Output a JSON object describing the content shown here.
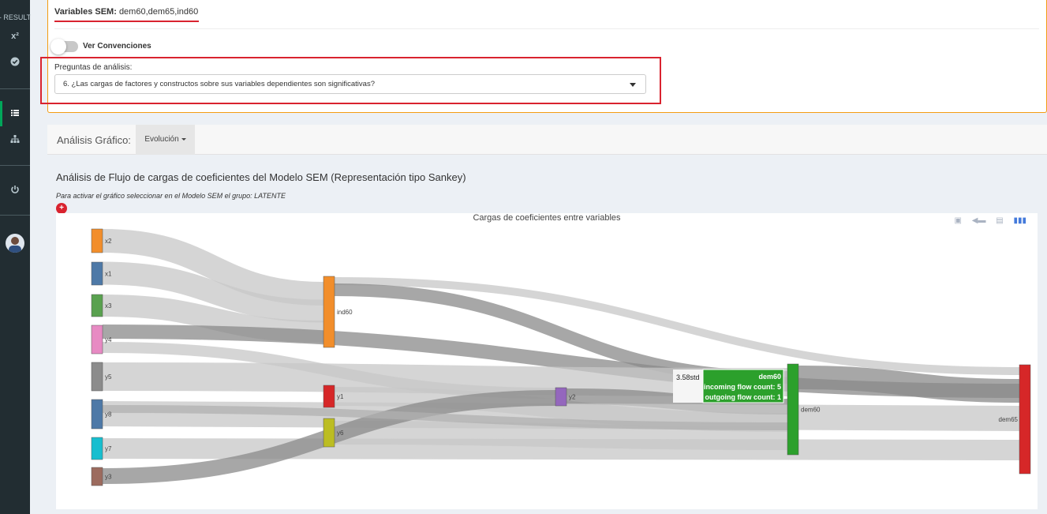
{
  "sidebar": {
    "header_label": "- RESULT",
    "x2_label": "x²",
    "check_icon": "check-circle-icon",
    "list_icon": "list-icon",
    "sitemap_icon": "sitemap-icon",
    "power_icon": "power-icon"
  },
  "top_panel": {
    "variables_label": "Variables SEM:",
    "variables_value": "dem60,dem65,ind60",
    "toggle_label": "Ver Convenciones",
    "preguntas_label": "Preguntas de análisis:",
    "selected_question": "6. ¿Las cargas de factores y constructos sobre sus variables dependientes son significativas?"
  },
  "graph_bar": {
    "title": "Análisis Gráfico:",
    "dropdown_label": "Evolución"
  },
  "section": {
    "title": "Análisis de Flujo de cargas de coeficientes del Modelo SEM (Representación tipo Sankey)",
    "note": "Para activar el gráfico seleccionar en el Modelo SEM el grupo: LATENTE"
  },
  "chart_data": {
    "type": "sankey",
    "title": "Cargas de coeficientes entre variables",
    "nodes": [
      {
        "name": "x2",
        "color": "#f28e2b"
      },
      {
        "name": "x1",
        "color": "#4e79a7"
      },
      {
        "name": "x3",
        "color": "#59a14f"
      },
      {
        "name": "y4",
        "color": "#e78ac3"
      },
      {
        "name": "y5",
        "color": "#8c8c8c"
      },
      {
        "name": "y8",
        "color": "#4e79a7"
      },
      {
        "name": "y7",
        "color": "#17becf"
      },
      {
        "name": "y3",
        "color": "#9c6b5e"
      },
      {
        "name": "ind60",
        "color": "#f28e2b"
      },
      {
        "name": "y1",
        "color": "#d62728"
      },
      {
        "name": "y6",
        "color": "#bcbd22"
      },
      {
        "name": "y2",
        "color": "#9467bd"
      },
      {
        "name": "dem60",
        "color": "#2ca02c"
      },
      {
        "name": "dem65",
        "color": "#d62728"
      }
    ],
    "links": [
      {
        "source": "x2",
        "target": "ind60"
      },
      {
        "source": "x1",
        "target": "ind60"
      },
      {
        "source": "x3",
        "target": "ind60"
      },
      {
        "source": "y4",
        "target": "dem60"
      },
      {
        "source": "y4",
        "target": "y2"
      },
      {
        "source": "y5",
        "target": "dem60"
      },
      {
        "source": "y8",
        "target": "dem65"
      },
      {
        "source": "y7",
        "target": "dem65"
      },
      {
        "source": "y3",
        "target": "y2"
      },
      {
        "source": "ind60",
        "target": "dem60"
      },
      {
        "source": "ind60",
        "target": "dem65"
      },
      {
        "source": "y1",
        "target": "dem60"
      },
      {
        "source": "y6",
        "target": "dem60"
      },
      {
        "source": "y2",
        "target": "dem60"
      },
      {
        "source": "dem60",
        "target": "dem65"
      }
    ],
    "tooltip": {
      "value": "3.58std",
      "node": "dem60",
      "incoming": "incoming flow count: 5",
      "outgoing": "outgoing flow count: 1"
    }
  },
  "modebar": [
    "camera-icon",
    "tag-icon",
    "copy-icon",
    "bar-chart-icon"
  ]
}
